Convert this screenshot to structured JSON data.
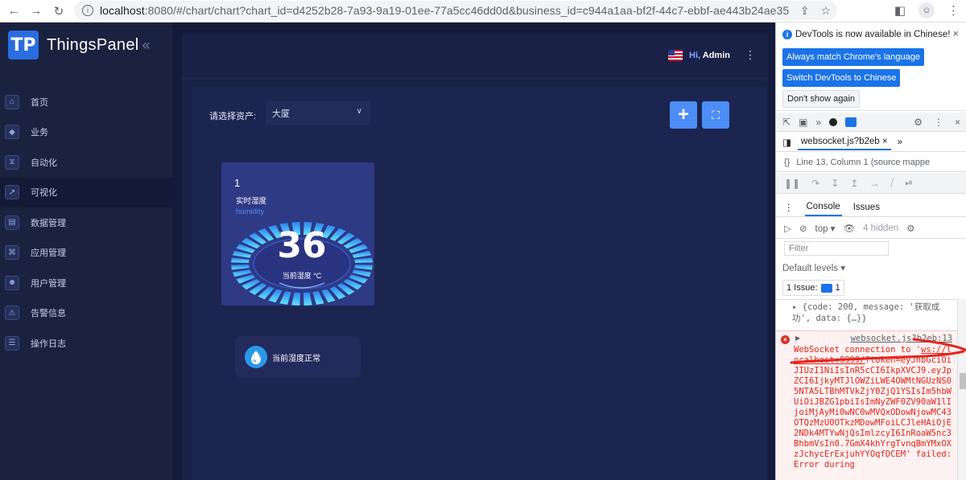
{
  "browser": {
    "url_host": "localhost",
    "url_rest": ":8080/#/chart/chart?chart_id=d4252b28-7a93-9a19-01ee-77a5cc46dd0d&business_id=c944a1aa-bf2f-44c7-ebbf-ae443b24ae35",
    "back_icon": "←",
    "forward_icon": "→",
    "reload_icon": "↻",
    "share_icon": "⇪",
    "star_icon": "☆",
    "sidepanel_icon": "◧",
    "menu_icon": "⋮",
    "profile_icon": "☺"
  },
  "app": {
    "brand": {
      "name": "ThingsPanel",
      "logo_glyph": "TP",
      "collapse_glyph": "«"
    },
    "menu": [
      {
        "label": "首页",
        "icon": "⌂",
        "active": false
      },
      {
        "label": "业务",
        "icon": "◆",
        "active": false
      },
      {
        "label": "自动化",
        "icon": "⧖",
        "active": false
      },
      {
        "label": "可视化",
        "icon": "↗",
        "active": true
      },
      {
        "label": "数据管理",
        "icon": "▤",
        "active": false
      },
      {
        "label": "应用管理",
        "icon": "⌘",
        "active": false
      },
      {
        "label": "用户管理",
        "icon": "☻",
        "active": false
      },
      {
        "label": "告警信息",
        "icon": "⚠",
        "active": false
      },
      {
        "label": "操作日志",
        "icon": "☰",
        "active": false
      }
    ],
    "header": {
      "greeting": "Hi,",
      "user": "Admin",
      "menu_glyph": "⋮"
    },
    "toolbar": {
      "asset_label": "请选择资产:",
      "asset_value": "大厦",
      "caret": "∨",
      "add_glyph": "+",
      "fullscreen_glyph": "⛶"
    },
    "card": {
      "index": "1",
      "title": "实时湿度",
      "subtitle": "humidity",
      "value": "36",
      "value_label": "当前湿度 °C",
      "gauge_fraction": 1.0,
      "gauge_color_start": "#2f80f0",
      "gauge_color_end": "#62e3ff"
    },
    "status": {
      "text": "当前湿度正常",
      "icon_color": "#2a98e9"
    }
  },
  "devtools": {
    "notice": "DevTools is now available in Chinese!",
    "btn_match": "Always match Chrome's language",
    "btn_switch": "Switch DevTools to Chinese",
    "btn_dont": "Don't show again",
    "close_glyph": "×",
    "source_tab": "websocket.js?b2eb",
    "source_loc": "Line 13, Column 1  (source mappe",
    "braces": "{}",
    "console_tab": "Console",
    "issues_tab": "Issues",
    "context": "top ▾",
    "hidden": "4 hidden",
    "filter_placeholder": "Filter",
    "levels": "Default levels ▾",
    "issues_count": "1 Issue:",
    "issues_num": "1",
    "log_line1": "{code: 200, message: '获取成功', data: {…}}",
    "err_source": "websocket.js?b2eb:13",
    "err_prefix": "WebSocket connection to '",
    "err_url": "ws://localhost:9999/",
    "err_token": "?token=eyJhbGciOiJIUzI1NiIsInR5cCI6IkpXVCJ9.eyJpZCI6IjkyMTJlOWZiLWE4OWMtNGUzNS05NTA5LTBhMTVkZjY0ZjQ1YSIsIm5hbWUiOiJBZG1pbiIsImNyZWF0ZV90aW1lIjoiMjAyMi0wNC0wMVQxODowNjowMC43OTQzMzU0OTkzMDowMFoiLCJleHAiOjE2NDk4MTYwNjQsImlzcyI6InRoaW5nc3BhbmVsIn0.7GmX4khYrgTvnqBmYMxOXzJchycErExjuhYYOqfDCEM'",
    "err_suffix": " failed: Error during"
  }
}
